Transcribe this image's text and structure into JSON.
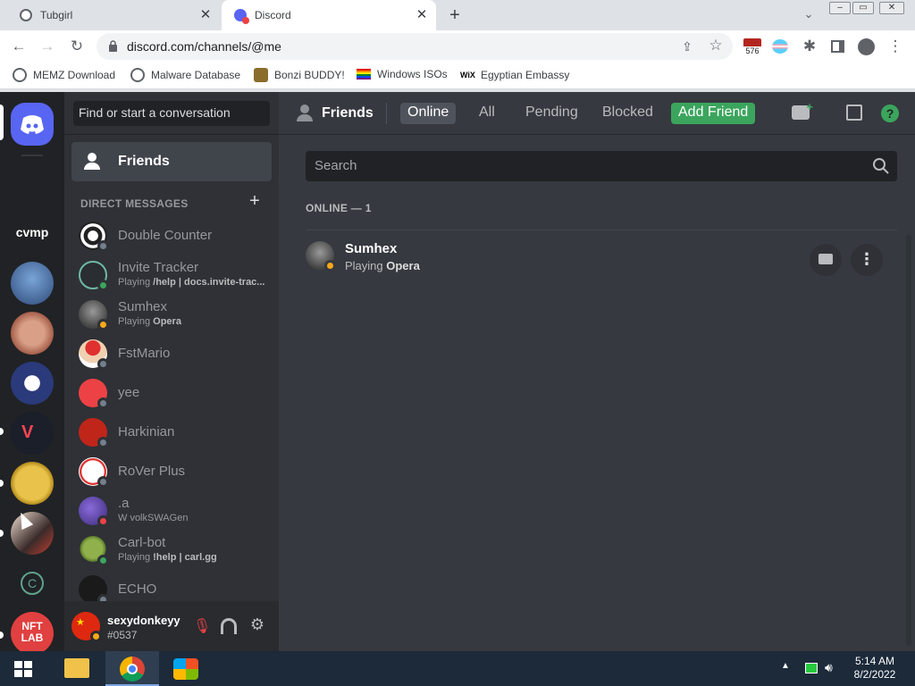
{
  "browser": {
    "tabs": [
      {
        "title": "Tubgirl",
        "active": false
      },
      {
        "title": "Discord",
        "active": true
      }
    ],
    "url": "discord.com/channels/@me",
    "extension_badge": "576",
    "bookmarks": [
      {
        "label": "MEMZ Download",
        "icon": "globe-icon"
      },
      {
        "label": "Malware Database",
        "icon": "globe-icon"
      },
      {
        "label": "Bonzi BUDDY!",
        "icon": "bonzi-icon"
      },
      {
        "label": "Windows ISOs",
        "icon": "rainbow-flag-icon"
      },
      {
        "label": "Egyptian Embassy",
        "icon": "wix-icon"
      }
    ]
  },
  "discord": {
    "colors": {
      "blurple": "#5865f2",
      "online": "#3ba55d",
      "idle": "#faa81a",
      "dnd": "#ed4245",
      "offline": "#747f8d"
    },
    "servers": [
      {
        "name": "home",
        "label": ""
      },
      {
        "name": "cvmp",
        "label": "cvmp"
      },
      {
        "name": "megamind",
        "label": ""
      },
      {
        "name": "face",
        "label": ""
      },
      {
        "name": "monopoly",
        "label": ""
      },
      {
        "name": "valorant",
        "label": ""
      },
      {
        "name": "coin",
        "label": ""
      },
      {
        "name": "anime",
        "label": ""
      },
      {
        "name": "c-logo",
        "label": ""
      },
      {
        "name": "nft-lab",
        "label": "NFT LAB"
      }
    ],
    "search_placeholder": "Find or start a conversation",
    "friends_nav_label": "Friends",
    "dm_header": "DIRECT MESSAGES",
    "dms": [
      {
        "name": "Double Counter",
        "sub": "",
        "sub_bold": "",
        "status": "offline"
      },
      {
        "name": "Invite Tracker",
        "sub": "Playing ",
        "sub_bold": "/help | docs.invite-trac...",
        "status": "online"
      },
      {
        "name": "Sumhex",
        "sub": "Playing ",
        "sub_bold": "Opera",
        "status": "idle"
      },
      {
        "name": "FstMario",
        "sub": "",
        "sub_bold": "",
        "status": "offline"
      },
      {
        "name": "yee",
        "sub": "",
        "sub_bold": "",
        "status": "offline"
      },
      {
        "name": "Harkinian",
        "sub": "",
        "sub_bold": "",
        "status": "offline"
      },
      {
        "name": "RoVer Plus",
        "sub": "",
        "sub_bold": "",
        "status": "offline"
      },
      {
        "name": ".a",
        "sub": "W volkSWAGen",
        "sub_bold": "",
        "status": "dnd"
      },
      {
        "name": "Carl-bot",
        "sub": "Playing ",
        "sub_bold": "!help | carl.gg",
        "status": "online"
      },
      {
        "name": "ECHO",
        "sub": "",
        "sub_bold": "",
        "status": "offline"
      }
    ],
    "user": {
      "name": "sexydonkeyy",
      "tag": "#0537",
      "status": "idle"
    },
    "topbar": {
      "title": "Friends",
      "tabs": [
        "Online",
        "All",
        "Pending",
        "Blocked"
      ],
      "add_friend": "Add Friend"
    },
    "friends_search_placeholder": "Search",
    "online_header": "ONLINE — 1",
    "online_friends": [
      {
        "name": "Sumhex",
        "activity_prefix": "Playing ",
        "activity": "Opera",
        "status": "idle"
      }
    ]
  },
  "taskbar": {
    "time": "5:14 AM",
    "date": "8/2/2022"
  }
}
